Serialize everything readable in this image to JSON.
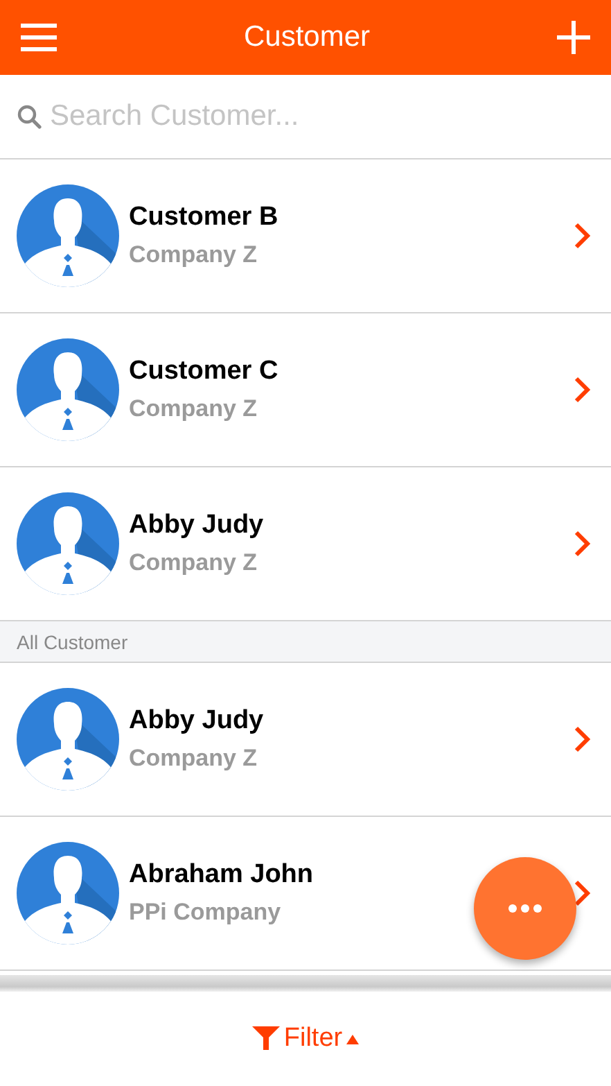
{
  "header": {
    "title": "Customer"
  },
  "search": {
    "placeholder": "Search Customer..."
  },
  "sections": [
    {
      "customers": [
        {
          "name": "Customer B",
          "company": "Company Z"
        },
        {
          "name": "Customer C",
          "company": "Company Z"
        },
        {
          "name": "Abby Judy",
          "company": "Company Z"
        }
      ]
    },
    {
      "title": "All Customer",
      "customers": [
        {
          "name": "Abby Judy",
          "company": "Company Z"
        },
        {
          "name": "Abraham John",
          "company": "PPi Company"
        }
      ]
    }
  ],
  "filter": {
    "label": "Filter"
  }
}
